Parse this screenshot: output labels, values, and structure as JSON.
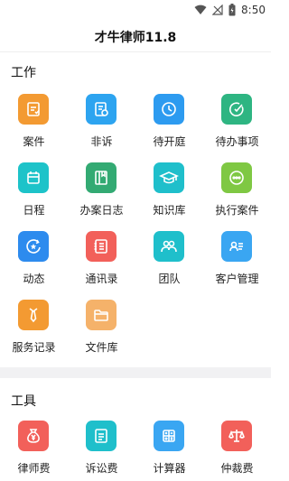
{
  "status_bar": {
    "time": "8:50",
    "icons": [
      "wifi-icon",
      "signal-icon",
      "battery-icon"
    ]
  },
  "header": {
    "title": "才牛律师11.8"
  },
  "work_section": {
    "title": "工作",
    "items": [
      {
        "label": "案件",
        "icon": "case-icon",
        "color": "#F39A32"
      },
      {
        "label": "非诉",
        "icon": "non-litigation-icon",
        "color": "#2DA4F0"
      },
      {
        "label": "待开庭",
        "icon": "clock-icon",
        "color": "#2D9BF0"
      },
      {
        "label": "待办事项",
        "icon": "check-circle-icon",
        "color": "#2EB582"
      },
      {
        "label": "日程",
        "icon": "calendar-icon",
        "color": "#1DC3C9"
      },
      {
        "label": "办案日志",
        "icon": "book-icon",
        "color": "#33AA73"
      },
      {
        "label": "知识库",
        "icon": "graduation-cap-icon",
        "color": "#1FBFCB"
      },
      {
        "label": "执行案件",
        "icon": "more-dots-icon",
        "color": "#7FC843"
      },
      {
        "label": "动态",
        "icon": "star-refresh-icon",
        "color": "#2D8BEE"
      },
      {
        "label": "通讯录",
        "icon": "address-book-icon",
        "color": "#F2605A"
      },
      {
        "label": "团队",
        "icon": "team-icon",
        "color": "#1FBFCB"
      },
      {
        "label": "客户管理",
        "icon": "client-card-icon",
        "color": "#3AA6F2"
      },
      {
        "label": "服务记录",
        "icon": "tie-icon",
        "color": "#F39A32"
      },
      {
        "label": "文件库",
        "icon": "folder-icon",
        "color": "#F5B26A"
      }
    ]
  },
  "tools_section": {
    "title": "工具",
    "items": [
      {
        "label": "律师费",
        "icon": "money-bag-icon",
        "color": "#F2605A"
      },
      {
        "label": "诉讼费",
        "icon": "litigation-fee-icon",
        "color": "#1FBFCB"
      },
      {
        "label": "计算器",
        "icon": "calculator-icon",
        "color": "#3AA6F2"
      },
      {
        "label": "仲裁费",
        "icon": "scales-icon",
        "color": "#F2605A"
      }
    ]
  }
}
